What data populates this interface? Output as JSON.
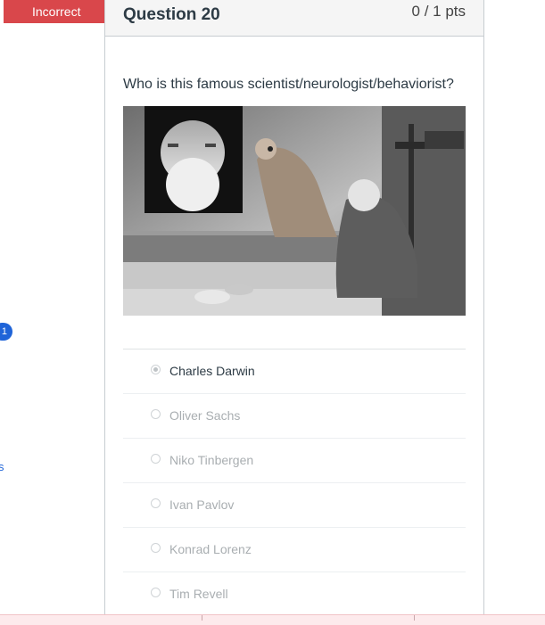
{
  "status": {
    "label": "Incorrect",
    "color": "#d9474b"
  },
  "question": {
    "title": "Question 20",
    "points": "0 / 1 pts",
    "prompt": "Who is this famous scientist/neurologist/behaviorist?"
  },
  "answers": [
    {
      "label": "Charles Darwin",
      "selected": true
    },
    {
      "label": "Oliver Sachs",
      "selected": false
    },
    {
      "label": "Niko Tinbergen",
      "selected": false
    },
    {
      "label": "Ivan Pavlov",
      "selected": false
    },
    {
      "label": "Konrad Lorenz",
      "selected": false
    },
    {
      "label": "Tim Revell",
      "selected": false
    }
  ],
  "left_sidebar": {
    "badge": "1",
    "partial_link": "s"
  },
  "image": {
    "kind": "black-and-white photograph: portrait inset and dog experiment scene"
  },
  "colors": {
    "accent": "#1f64d8",
    "incorrect": "#d9474b",
    "text": "#2d3b45"
  }
}
